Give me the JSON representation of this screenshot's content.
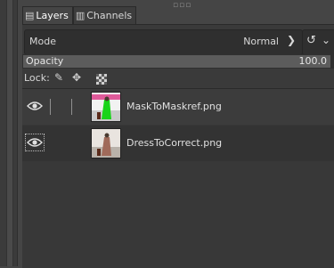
{
  "tabs": [
    {
      "label": "Layers",
      "icon": "layers-icon",
      "active": true
    },
    {
      "label": "Channels",
      "icon": "channels-icon",
      "active": false
    }
  ],
  "mode": {
    "label": "Mode",
    "value": "Normal"
  },
  "opacity": {
    "label": "Opacity",
    "value": "100.0"
  },
  "lock": {
    "label": "Lock:",
    "icons": [
      "lock-pixels-icon",
      "lock-position-icon",
      "lock-alpha-icon"
    ]
  },
  "layers": [
    {
      "name": "MaskToMaskref.png",
      "visible": true
    },
    {
      "name": "DressToCorrect.png",
      "visible": true
    }
  ]
}
